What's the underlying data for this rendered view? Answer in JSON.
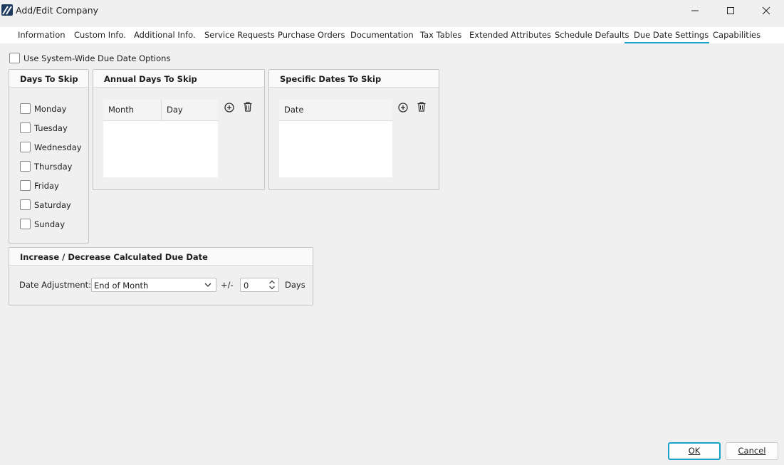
{
  "window": {
    "title": "Add/Edit Company",
    "brand_color": "#1f3a5f",
    "accent_color": "#1aa3c7"
  },
  "tabs": [
    {
      "label": "Information",
      "active": false
    },
    {
      "label": "Custom Info.",
      "active": false
    },
    {
      "label": "Additional Info.",
      "active": false
    },
    {
      "label": "Service Requests",
      "active": false
    },
    {
      "label": "Purchase Orders",
      "active": false
    },
    {
      "label": "Documentation",
      "active": false
    },
    {
      "label": "Tax Tables",
      "active": false
    },
    {
      "label": "Extended Attributes",
      "active": false
    },
    {
      "label": "Schedule Defaults",
      "active": false
    },
    {
      "label": "Due Date Settings",
      "active": true
    },
    {
      "label": "Capabilities",
      "active": false
    }
  ],
  "system_wide": {
    "label": "Use System-Wide Due Date Options",
    "checked": false
  },
  "days_to_skip": {
    "title": "Days To Skip",
    "days": [
      {
        "label": "Monday",
        "checked": false
      },
      {
        "label": "Tuesday",
        "checked": false
      },
      {
        "label": "Wednesday",
        "checked": false
      },
      {
        "label": "Thursday",
        "checked": false
      },
      {
        "label": "Friday",
        "checked": false
      },
      {
        "label": "Saturday",
        "checked": false
      },
      {
        "label": "Sunday",
        "checked": false
      }
    ]
  },
  "annual_days": {
    "title": "Annual Days To Skip",
    "columns": [
      "Month",
      "Day"
    ],
    "rows": [],
    "add_icon": "add-circle-icon",
    "delete_icon": "trash-icon"
  },
  "specific_dates": {
    "title": "Specific Dates To Skip",
    "columns": [
      "Date"
    ],
    "rows": [],
    "add_icon": "add-circle-icon",
    "delete_icon": "trash-icon"
  },
  "adjustment": {
    "title": "Increase / Decrease Calculated Due Date",
    "label": "Date Adjustment:",
    "selected": "End of Month",
    "plus_minus": "+/-",
    "value": "0",
    "unit": "Days"
  },
  "buttons": {
    "ok": "OK",
    "cancel": "Cancel"
  }
}
